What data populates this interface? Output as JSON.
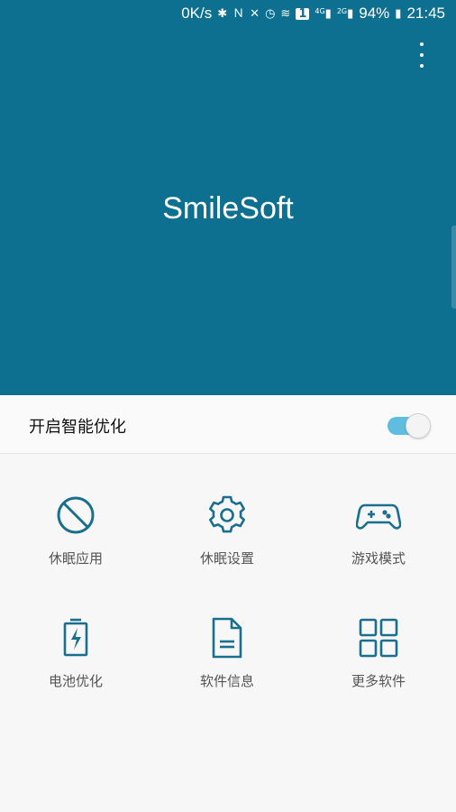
{
  "status_bar": {
    "speed": "0K/s",
    "sim_badge": "1",
    "network_4g": "4G",
    "network_2g": "2G",
    "battery": "94%",
    "time": "21:45"
  },
  "header": {
    "title": "SmileSoft"
  },
  "toggle": {
    "label": "开启智能优化",
    "enabled": true
  },
  "grid": {
    "items": [
      {
        "label": "休眠应用",
        "icon": "block-icon"
      },
      {
        "label": "休眠设置",
        "icon": "gear-icon"
      },
      {
        "label": "游戏模式",
        "icon": "gamepad-icon"
      },
      {
        "label": "电池优化",
        "icon": "battery-charging-icon"
      },
      {
        "label": "软件信息",
        "icon": "document-icon"
      },
      {
        "label": "更多软件",
        "icon": "grid-icon"
      }
    ]
  },
  "colors": {
    "header_bg": "#0e7090",
    "icon": "#1a6f8e",
    "toggle_on": "#5fbde0"
  }
}
